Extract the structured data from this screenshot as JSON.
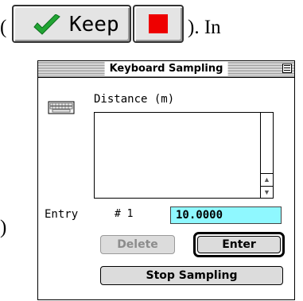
{
  "document": {
    "paren_open": "(",
    "after_buttons": "). In",
    "paren_close": ")"
  },
  "inline_buttons": {
    "keep_label": "Keep",
    "keep_icon": "checkmark-icon",
    "stop_icon": "stop-square-icon",
    "check_color": "#22a534",
    "stop_color": "#ee0000"
  },
  "window": {
    "title": "Keyboard Sampling",
    "column_header": "Distance (m)",
    "list_values": [],
    "entry_label": "Entry",
    "entry_number": "# 1",
    "entry_value": "10.0000",
    "entry_bg_color": "#8ff8ff",
    "delete_label": "Delete",
    "enter_label": "Enter",
    "stop_sampling_label": "Stop Sampling"
  }
}
